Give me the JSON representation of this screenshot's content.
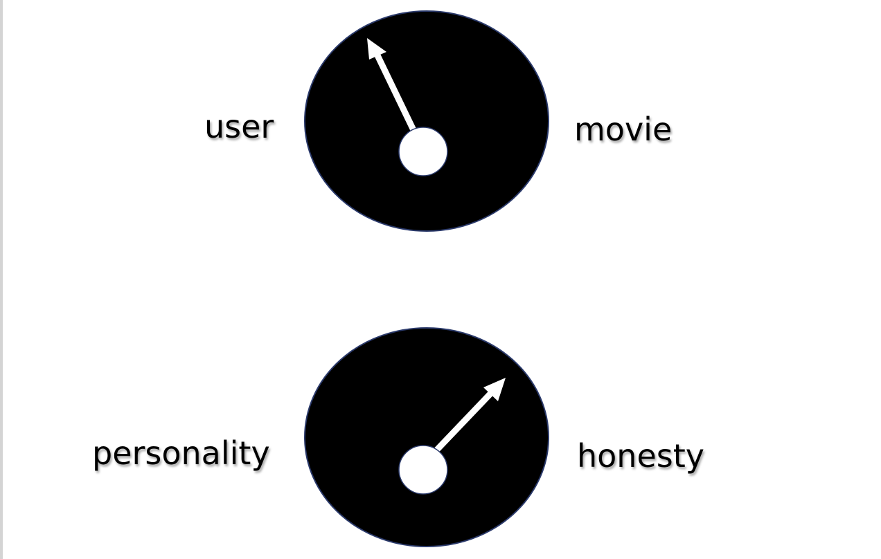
{
  "colors": {
    "dial_fill": "#000000",
    "dial_stroke": "#2b3a6b",
    "needle": "#ffffff",
    "hub": "#ffffff",
    "label": "#000000"
  },
  "dials": [
    {
      "left_label": "user",
      "right_label": "movie",
      "icon": "gauge-dial-icon"
    },
    {
      "left_label": "personality",
      "right_label": "honesty",
      "icon": "gauge-dial-icon"
    }
  ]
}
